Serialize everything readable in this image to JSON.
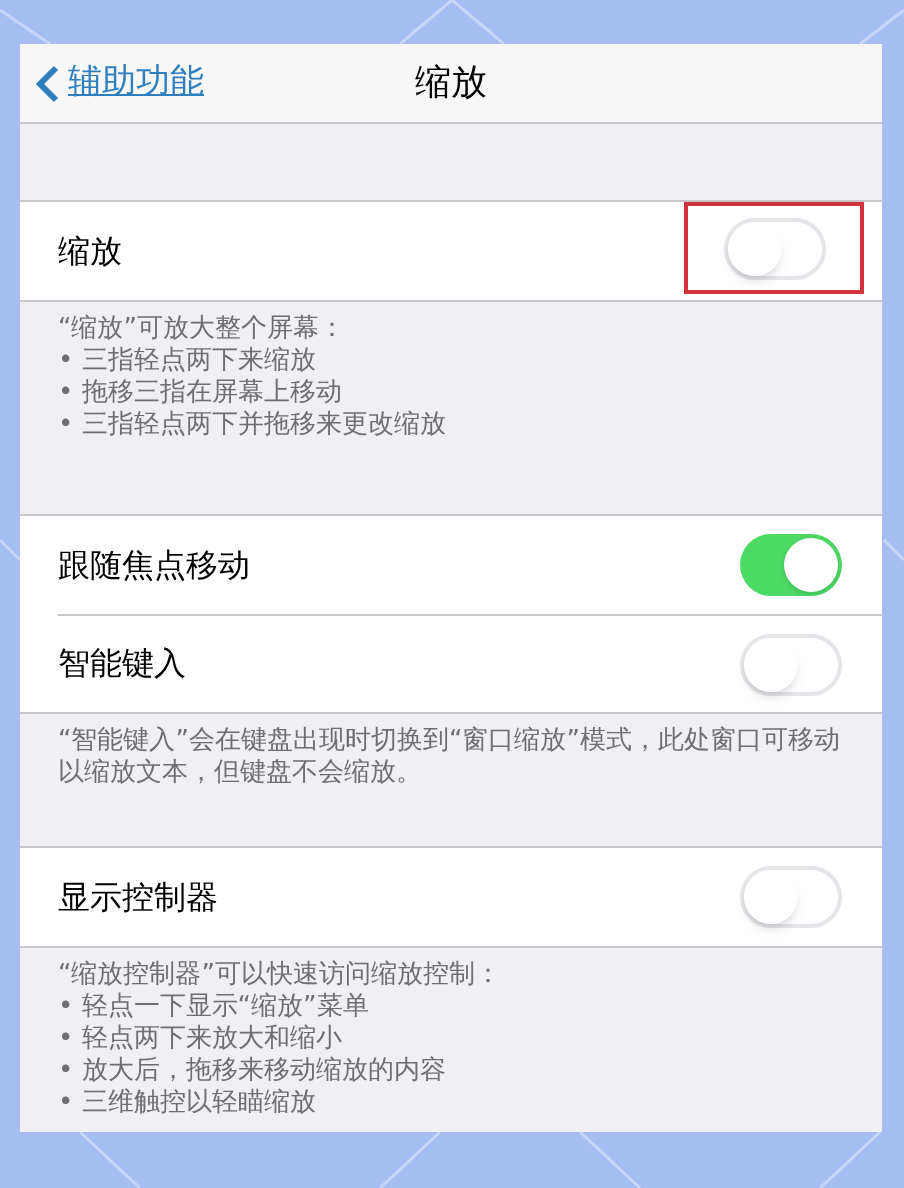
{
  "nav": {
    "back": "辅助功能",
    "title": "缩放"
  },
  "sections": [
    {
      "rows": [
        {
          "label": "缩放",
          "on": false,
          "highlighted": true
        }
      ],
      "footer": [
        "“缩放”可放大整个屏幕：",
        "• 三指轻点两下来缩放",
        "• 拖移三指在屏幕上移动",
        "• 三指轻点两下并拖移来更改缩放"
      ]
    },
    {
      "rows": [
        {
          "label": "跟随焦点移动",
          "on": true,
          "highlighted": false
        },
        {
          "label": "智能键入",
          "on": false,
          "highlighted": false
        }
      ],
      "footer": [
        "“智能键入”会在键盘出现时切换到“窗口缩放”模式，此处窗口可移动以缩放文本，但键盘不会缩放。"
      ]
    },
    {
      "rows": [
        {
          "label": "显示控制器",
          "on": false,
          "highlighted": false
        }
      ],
      "footer": [
        "“缩放控制器”可以快速访问缩放控制：",
        "• 轻点一下显示“缩放”菜单",
        "• 轻点两下来放大和缩小",
        "• 放大后，拖移来移动缩放的内容",
        "• 三维触控以轻瞄缩放"
      ]
    }
  ]
}
